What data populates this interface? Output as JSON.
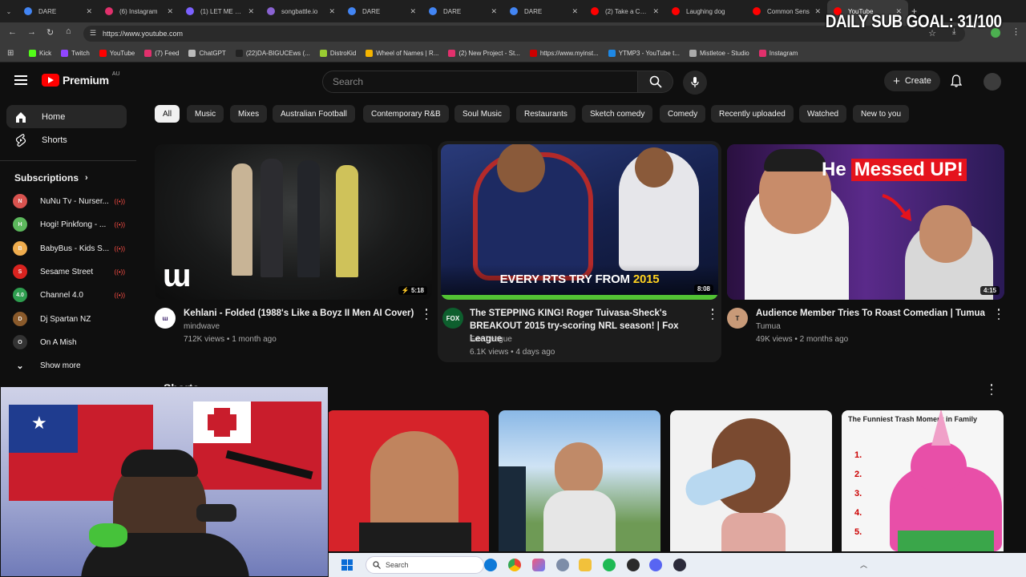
{
  "overlay": {
    "sub_goal": "DAILY SUB GOAL: 31/100"
  },
  "browser": {
    "tabs": [
      {
        "title": "DARE",
        "color": "#4285f4",
        "close": "✕"
      },
      {
        "title": "(6) Instagram",
        "color": "#e1306c",
        "close": "✕"
      },
      {
        "title": "(1) LET ME SMI",
        "color": "#7b61ff",
        "close": "✕"
      },
      {
        "title": "songbattle.io",
        "color": "#8a63d2",
        "close": "✕"
      },
      {
        "title": "DARE",
        "color": "#4285f4",
        "close": "✕"
      },
      {
        "title": "DARE",
        "color": "#4285f4",
        "close": "✕"
      },
      {
        "title": "DARE",
        "color": "#4285f4",
        "close": "✕"
      },
      {
        "title": "(2) Take a Chan",
        "color": "#ff0000",
        "close": "✕"
      },
      {
        "title": "Laughing dog",
        "color": "#ff0000",
        "close": ""
      },
      {
        "title": "Common Sens",
        "color": "#ff0000",
        "close": "✕"
      },
      {
        "title": "YouTube",
        "color": "#ff0000",
        "close": "✕"
      }
    ],
    "url": "https://www.youtube.com",
    "bookmarks": [
      {
        "label": "Kick",
        "color": "#53fc18"
      },
      {
        "label": "Twitch",
        "color": "#9146ff"
      },
      {
        "label": "YouTube",
        "color": "#ff0000"
      },
      {
        "label": "(7) Feed",
        "color": "#e1306c"
      },
      {
        "label": "ChatGPT",
        "color": "#bbbbbb"
      },
      {
        "label": "(22)DA-BIGUCEws (...",
        "color": "#222222"
      },
      {
        "label": "DistroKid",
        "color": "#9acd32"
      },
      {
        "label": "Wheel of Names | R...",
        "color": "#f4b400"
      },
      {
        "label": "(2) New Project - St...",
        "color": "#e1306c"
      },
      {
        "label": "https://www.myinst...",
        "color": "#cc0000"
      },
      {
        "label": "YTMP3 - YouTube t...",
        "color": "#1e88e5"
      },
      {
        "label": "Mistletoe - Studio",
        "color": "#aaaaaa"
      },
      {
        "label": "Instagram",
        "color": "#e1306c"
      }
    ]
  },
  "youtube": {
    "logo": "Premium",
    "region": "AU",
    "search_placeholder": "Search",
    "create_label": "Create",
    "sidebar": {
      "home": "Home",
      "shorts": "Shorts",
      "subscriptions_header": "Subscriptions",
      "subscriptions": [
        {
          "name": "NuNu Tv - Nurser...",
          "color": "#d9534f",
          "initial": "N"
        },
        {
          "name": "Hogi! Pinkfong - ...",
          "color": "#5cb85c",
          "initial": "H"
        },
        {
          "name": "BabyBus - Kids S...",
          "color": "#f0ad4e",
          "initial": "B"
        },
        {
          "name": "Sesame Street",
          "color": "#d9231f",
          "initial": "S"
        },
        {
          "name": "Channel 4.0",
          "color": "#2e9e4f",
          "initial": "4.0"
        },
        {
          "name": "Dj Spartan NZ",
          "color": "#8a5a2b",
          "initial": "D"
        },
        {
          "name": "On A Mish",
          "color": "#333333",
          "initial": "O"
        }
      ],
      "show_more": "Show more"
    },
    "chips": [
      "All",
      "Music",
      "Mixes",
      "Australian Football",
      "Contemporary R&B",
      "Soul Music",
      "Restaurants",
      "Sketch comedy",
      "Comedy",
      "Recently uploaded",
      "Watched",
      "New to you"
    ],
    "videos": [
      {
        "title": "Kehlani - Folded (1988's Like a Boyz II Men AI Cover)",
        "channel": "mindwave",
        "views": "712K views",
        "age": "1 month ago",
        "duration": "5:18"
      },
      {
        "title": "The STEPPING KING! Roger Tuivasa-Sheck's BREAKOUT 2015 try-scoring NRL season! | Fox League",
        "channel": "Fox League",
        "views": "6.1K views",
        "age": "4 days ago",
        "duration": "8:08",
        "thumb_text": "EVERY RTS TRY FROM",
        "thumb_year": "2015"
      },
      {
        "title": "Audience Member Tries To Roast Comedian | Tumua",
        "channel": "Tumua",
        "views": "49K views",
        "age": "2 months ago",
        "duration": "4:15",
        "thumb_text_a": "He",
        "thumb_text_b": "Messed UP!"
      }
    ],
    "shorts_header": "Shorts",
    "short_thumb_text": "The Funniest Trash Moment in Family",
    "short_numbers": [
      "1.",
      "2.",
      "3.",
      "4.",
      "5."
    ]
  },
  "taskbar": {
    "search_placeholder": "Search"
  }
}
